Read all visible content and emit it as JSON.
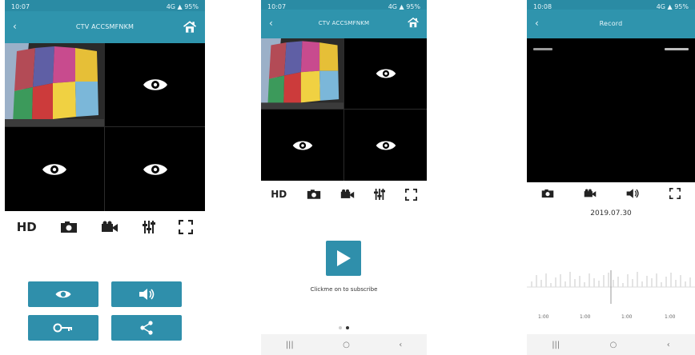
{
  "screens": [
    {
      "status_time": "10:07",
      "status_right": "4G ▲ 95%",
      "title": "CTV ACCSMFNKM",
      "toolbar": {
        "hd_label": "HD"
      }
    },
    {
      "status_time": "10:07",
      "status_right": "4G ▲ 95%",
      "title": "CTV ACCSMFNKM",
      "toolbar": {
        "hd_label": "HD"
      },
      "play_caption": "Clickme on to subscribe",
      "page_dots": 2,
      "active_dot": 1
    },
    {
      "status_time": "10:08",
      "status_right": "4G ▲ 95%",
      "title": "Record",
      "date": "2019.07.30",
      "wave_labels": [
        "1:00",
        "1:00",
        "1:00",
        "1:00"
      ]
    }
  ],
  "icons": {
    "back": "back-arrow-icon",
    "home": "home-icon",
    "eye": "eye-icon",
    "camera": "camera-icon",
    "video": "video-camera-icon",
    "settings": "settings-icon",
    "fullscreen": "fullscreen-icon",
    "sound": "speaker-icon",
    "key": "key-icon",
    "share": "share-icon",
    "play": "play-icon"
  },
  "colors": {
    "accent": "#2f8fab",
    "appbar": "#2f94ad"
  }
}
